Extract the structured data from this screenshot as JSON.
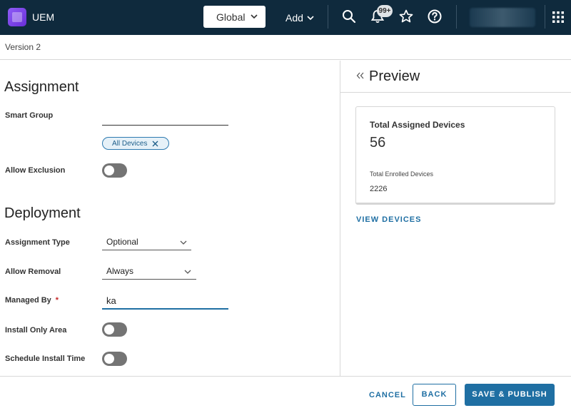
{
  "header": {
    "app_name": "UEM",
    "scope_select": "Global",
    "add_label": "Add",
    "notifications_badge": "99+",
    "icons": [
      "logo-icon",
      "chevron-down-icon",
      "search-icon",
      "bell-icon",
      "star-icon",
      "help-icon",
      "apps-grid-icon"
    ]
  },
  "breadcrumb": {
    "version": "Version 2"
  },
  "assignment": {
    "title": "Assignment",
    "smart_group_label": "Smart Group",
    "smart_group_value": "",
    "chip_label": "All Devices",
    "allow_exclusion_label": "Allow Exclusion",
    "allow_exclusion_on": false
  },
  "deployment": {
    "title": "Deployment",
    "assignment_type_label": "Assignment Type",
    "assignment_type_value": "Optional",
    "allow_removal_label": "Allow Removal",
    "allow_removal_value": "Always",
    "managed_by_label": "Managed By",
    "managed_by_required": "*",
    "managed_by_value": "ka",
    "install_only_area_label": "Install Only Area",
    "install_only_area_on": false,
    "schedule_install_time_label": "Schedule Install Time",
    "schedule_install_time_on": false
  },
  "preview": {
    "title": "Preview",
    "total_assigned_label": "Total Assigned Devices",
    "total_assigned_value": "56",
    "total_enrolled_label": "Total Enrolled Devices",
    "total_enrolled_value": "2226",
    "view_devices_label": "VIEW DEVICES"
  },
  "footer": {
    "cancel_label": "CANCEL",
    "back_label": "BACK",
    "save_publish_label": "SAVE & PUBLISH"
  },
  "colors": {
    "topbar": "#0f2a3d",
    "accent": "#1f6fa3",
    "toggle_off": "#747474",
    "required": "#c62828"
  }
}
